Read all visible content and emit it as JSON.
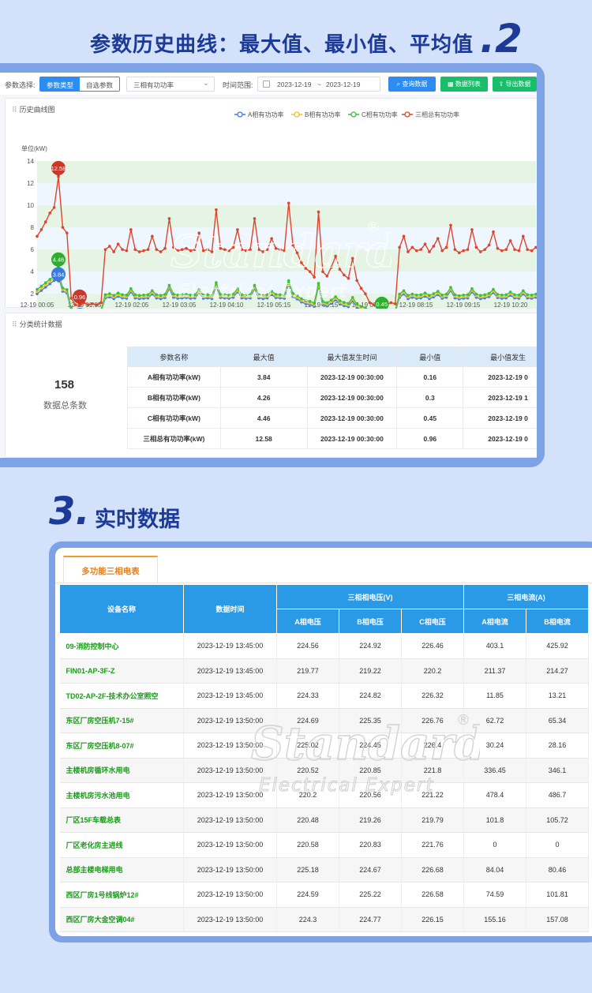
{
  "heading_top": {
    "title": "参数历史曲线：最大值、最小值、平均值",
    "number": ".2"
  },
  "heading_mid": {
    "number": "3.",
    "title": "实时数据"
  },
  "toolbar": {
    "param_label": "参数选择:",
    "param_types": [
      "参数类型",
      "自选参数"
    ],
    "select_value": "三相有功功率",
    "time_label": "时间范围:",
    "date_from": "2023-12-19",
    "date_sep": "~",
    "date_to": "2023-12-19",
    "buttons": [
      "查询数据",
      "数据列表",
      "导出数据"
    ]
  },
  "history_card": {
    "title": "历史曲线图"
  },
  "stats_card": {
    "title": "分类统计数据",
    "total": "158",
    "total_label": "数据总条数",
    "headers": [
      "参数名称",
      "最大值",
      "最大值发生时间",
      "最小值",
      "最小值发生"
    ],
    "rows": [
      [
        "A相有功功率(kW)",
        "3.84",
        "2023-12-19 00:30:00",
        "0.16",
        "2023-12-19 0"
      ],
      [
        "B相有功功率(kW)",
        "4.26",
        "2023-12-19 00:30:00",
        "0.3",
        "2023-12-19 1"
      ],
      [
        "C相有功功率(kW)",
        "4.46",
        "2023-12-19 00:30:00",
        "0.45",
        "2023-12-19 0"
      ],
      [
        "三相总有功功率(kW)",
        "12.58",
        "2023-12-19 00:30:00",
        "0.96",
        "2023-12-19 0"
      ]
    ]
  },
  "chart_data": {
    "type": "line",
    "ylabel": "单位(kW)",
    "ylim": [
      0.16,
      14
    ],
    "yticks": [
      "14",
      "12",
      "10",
      "8",
      "6",
      "4",
      "2",
      "0.16"
    ],
    "xticks": [
      "12-19 00:05",
      "12-19 01:05",
      "12-19 02:05",
      "12-19 03:05",
      "12-19 04:10",
      "12-19 05:15",
      "12-19 06:15",
      "12-19 07:15",
      "12-19 08:15",
      "12-19 09:15",
      "12-19 10:20"
    ],
    "legend_position": "top",
    "series": [
      {
        "name": "A相有功功率",
        "color": "#3f7ee8"
      },
      {
        "name": "B相有功功率",
        "color": "#f5c02a"
      },
      {
        "name": "C相有功功率",
        "color": "#3ac23a"
      },
      {
        "name": "三相总有功功率",
        "color": "#e0452c"
      }
    ],
    "total_values": [
      7.2,
      7.8,
      8.5,
      9.3,
      9.8,
      12.58,
      8.0,
      7.5,
      1.6,
      1.0,
      0.96,
      1.2,
      1.0,
      1.1,
      1.0,
      1.2,
      6.0,
      6.3,
      5.8,
      6.5,
      6.0,
      5.9,
      7.8,
      6.0,
      5.8,
      5.9,
      6.0,
      7.2,
      6.0,
      5.8,
      6.1,
      8.8,
      6.2,
      5.9,
      6.0,
      6.1,
      5.9,
      6.0,
      7.5,
      5.9,
      6.0,
      5.8,
      9.6,
      6.1,
      6.0,
      5.9,
      6.2,
      7.8,
      6.0,
      5.9,
      6.0,
      8.8,
      6.0,
      5.8,
      6.0,
      7.0,
      6.1,
      6.0,
      5.9,
      10.2,
      6.4,
      5.7,
      4.8,
      4.3,
      4.0,
      3.5,
      9.4,
      4.0,
      3.6,
      4.4,
      5.4,
      4.2,
      3.7,
      3.4,
      5.2,
      3.2,
      2.5,
      2.0,
      1.2,
      1.0,
      1.1,
      1.0,
      1.0,
      1.2,
      1.1,
      6.2,
      7.2,
      5.8,
      6.2,
      5.9,
      6.0,
      6.5,
      5.8,
      6.3,
      7.0,
      5.9,
      6.2,
      8.2,
      6.0,
      5.7,
      5.9,
      6.0,
      7.8,
      6.2,
      5.8,
      6.0,
      6.4,
      7.6,
      6.1,
      5.9,
      6.0,
      6.8,
      6.0,
      5.9,
      7.2,
      6.0,
      5.9,
      6.2
    ],
    "total_markers": [
      {
        "label": "12.58",
        "value": 12.58
      },
      {
        "label": "0.96",
        "value": 0.96
      }
    ],
    "phase_markers": [
      {
        "label": "4.46",
        "value": 4.46
      },
      {
        "label": "3.84",
        "value": 3.84
      },
      {
        "label": "0.16",
        "value": 0.16
      },
      {
        "label": "0.45",
        "value": 0.45
      }
    ]
  },
  "realtime": {
    "tab": "多功能三相电表",
    "headers": {
      "device": "设备名称",
      "time": "数据时间",
      "voltage_group": "三相相电压(V)",
      "current_group": "三相电流(A)",
      "va": "A相电压",
      "vb": "B相电压",
      "vc": "C相电压",
      "ia": "A相电流",
      "ib": "B相电流"
    },
    "rows": [
      [
        "09-消防控制中心",
        "2023-12-19 13:45:00",
        "224.56",
        "224.92",
        "226.46",
        "403.1",
        "425.92"
      ],
      [
        "FIN01-AP-3F-Z",
        "2023-12-19 13:45:00",
        "219.77",
        "219.22",
        "220.2",
        "211.37",
        "214.27"
      ],
      [
        "TD02-AP-2F-技术办公室照空",
        "2023-12-19 13:45:00",
        "224.33",
        "224.82",
        "226.32",
        "11.85",
        "13.21"
      ],
      [
        "东区厂房空压机7-15#",
        "2023-12-19 13:50:00",
        "224.69",
        "225.35",
        "226.76",
        "62.72",
        "65.34"
      ],
      [
        "东区厂房空压机8-07#",
        "2023-12-19 13:50:00",
        "225.02",
        "224.45",
        "226.4",
        "30.24",
        "28.16"
      ],
      [
        "主楼机房循环水用电",
        "2023-12-19 13:50:00",
        "220.52",
        "220.85",
        "221.8",
        "336.45",
        "346.1"
      ],
      [
        "主楼机房污水池用电",
        "2023-12-19 13:50:00",
        "220.2",
        "220.56",
        "221.22",
        "478.4",
        "486.7"
      ],
      [
        "厂区15F车载总表",
        "2023-12-19 13:50:00",
        "220.48",
        "219.26",
        "219.79",
        "101.8",
        "105.72"
      ],
      [
        "厂区老化房主进线",
        "2023-12-19 13:50:00",
        "220.58",
        "220.83",
        "221.76",
        "0",
        "0"
      ],
      [
        "总部主楼电梯用电",
        "2023-12-19 13:50:00",
        "225.18",
        "224.67",
        "226.68",
        "84.04",
        "80.46"
      ],
      [
        "西区厂房1号线锅炉12#",
        "2023-12-19 13:50:00",
        "224.59",
        "225.22",
        "226.58",
        "74.59",
        "101.81"
      ],
      [
        "西区厂房大金空调04#",
        "2023-12-19 13:50:00",
        "224.3",
        "224.77",
        "226.15",
        "155.16",
        "157.08"
      ]
    ]
  },
  "watermark": {
    "brand": "Standardel",
    "sub": "Electrical Expert",
    "mark": "®"
  }
}
